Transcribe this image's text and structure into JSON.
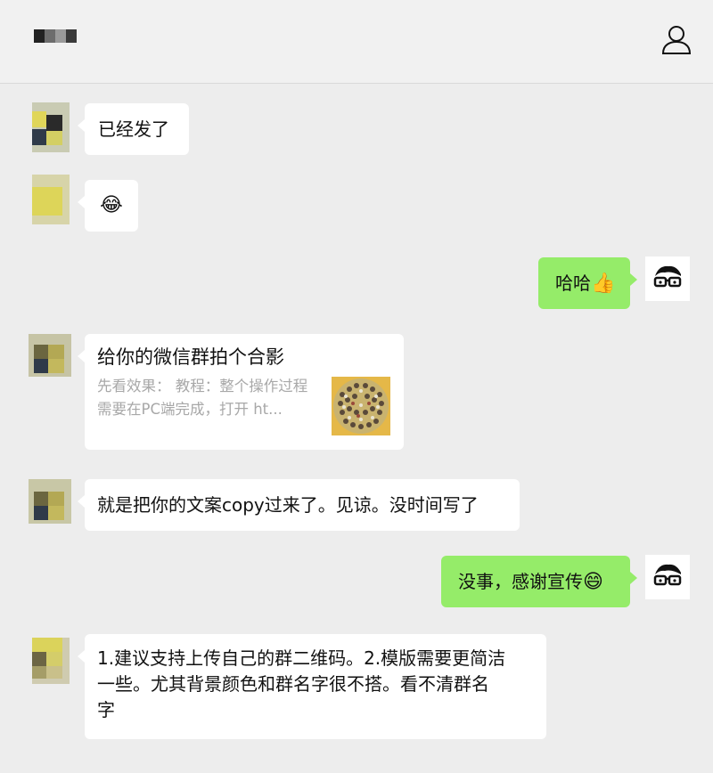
{
  "chat": {
    "messages": [
      {
        "text": "已经发了"
      },
      {
        "emoji": "😂"
      },
      {
        "text": "哈哈",
        "emoji": "👍"
      },
      {
        "link_card": {
          "title": "给你的微信群拍个合影",
          "description": "先看效果： 教程：整个操作过程需要在PC端完成，打开 ht..."
        }
      },
      {
        "text": "就是把你的文案copy过来了。见谅。没时间写了"
      },
      {
        "text": "没事，感谢宣传",
        "emoji": "😄"
      },
      {
        "lines": [
          "1.建议支持上传自己的群二维码。2.模版需要更简洁",
          "一些。尤其背景颜色和群名字很不搭。看不清群名",
          "字"
        ]
      }
    ]
  }
}
